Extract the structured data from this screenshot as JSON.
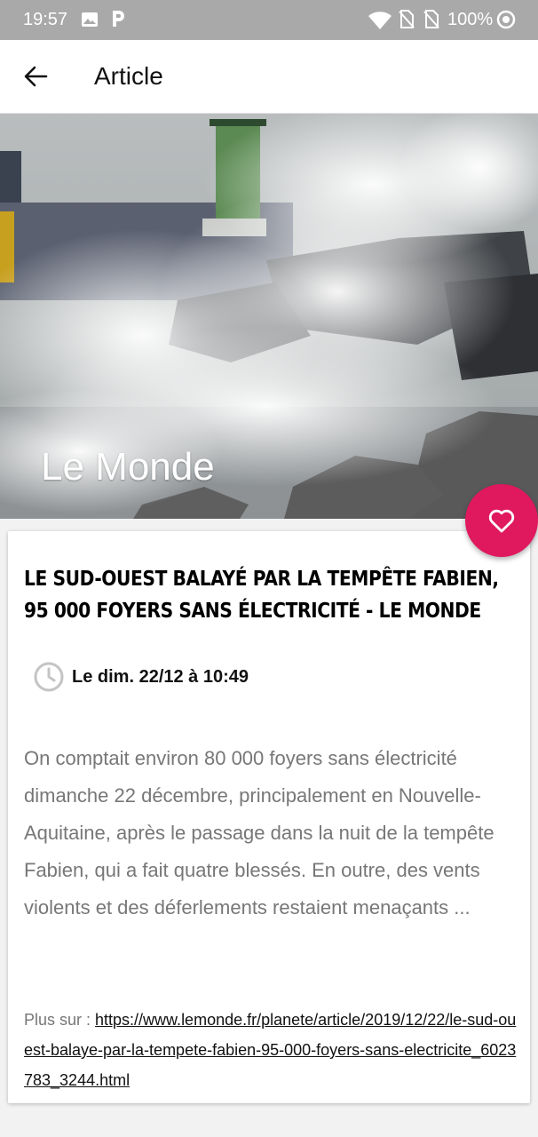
{
  "status_bar": {
    "time": "19:57",
    "battery": "100%",
    "icons": [
      "gallery-icon",
      "parking-icon",
      "wifi-icon",
      "sim-off-icon",
      "sim-off-icon",
      "sync-target-icon"
    ]
  },
  "app_bar": {
    "title": "Article",
    "back_icon": "arrow-left-icon"
  },
  "hero": {
    "source": "Le Monde"
  },
  "fab": {
    "icon": "heart-outline-icon",
    "color": "#e0185e"
  },
  "article": {
    "headline": "Le Sud-Ouest balayé par la tempête Fabien, 95 000 foyers sans électricité - Le Monde",
    "date": "Le dim. 22/12 à 10:49",
    "excerpt": "On comptait environ 80 000 foyers sans électricité dimanche 22 décembre, principalement en Nouvelle-Aquitaine, après le passage dans la nuit de la tempête Fabien, qui a fait quatre blessés. En outre, des vents violents et des déferlements restaient menaçants ...",
    "more_label": "Plus sur : ",
    "link": "https://www.lemonde.fr/planete/article/2019/12/22/le-sud-ouest-balaye-par-la-tempete-fabien-95-000-foyers-sans-electricite_6023783_3244.html"
  }
}
